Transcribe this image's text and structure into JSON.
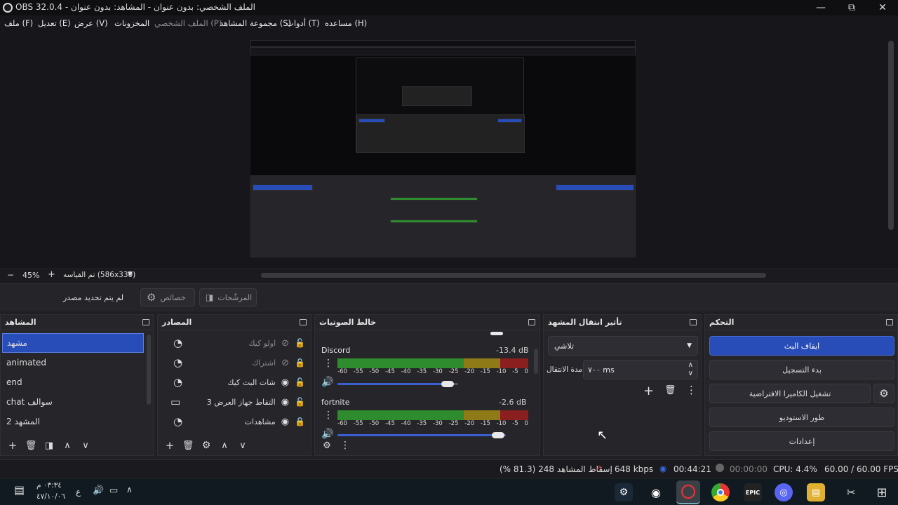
{
  "window": {
    "title": "OBS 32.0.4 - الملف الشخصي: بدون عنوان - المشاهد: بدون عنوان"
  },
  "menu": [
    {
      "label": "مساعده (H)"
    },
    {
      "label": "أدوات (T)"
    },
    {
      "label": "مجموعة المشاهد (S)"
    },
    {
      "label": "الملف الشخصي (P)"
    },
    {
      "label": "المخزونات"
    },
    {
      "label": "عرض (V)"
    },
    {
      "label": "تعديل (E)"
    },
    {
      "label": "ملف (F)"
    }
  ],
  "preview_bar": {
    "zoom": "45%",
    "scale": "تم القياسه (586x330)",
    "minus": "−",
    "plus": "+"
  },
  "context": {
    "no_source": "لم يتم تحديد مصدر",
    "properties": "خصائص",
    "filters": "المرشّحات"
  },
  "docks": {
    "scenes": {
      "title": "المشاهد",
      "items": [
        "مشهد",
        "animated",
        "end",
        "chat سوالف",
        "المشهد 2"
      ]
    },
    "sources": {
      "title": "المصادر",
      "items": [
        "اولو كيك",
        "اشتراك",
        "شات البث كيك",
        "التقاط جهاز العرض 3",
        "مشاهدات"
      ]
    },
    "mixer": {
      "title": "خالط الصوتيات",
      "channels": [
        {
          "name": "Discord",
          "db": "-13.4 dB",
          "level": 0.42
        },
        {
          "name": "fortnite",
          "db": "-2.6 dB",
          "level": 0.6
        }
      ],
      "ticks": [
        "-60",
        "-55",
        "-50",
        "-45",
        "-40",
        "-35",
        "-30",
        "-25",
        "-20",
        "-15",
        "-10",
        "-5",
        "0"
      ]
    },
    "transitions": {
      "title": "تأثير انتقال المشهد",
      "selected": "تلاشي",
      "duration_label": "مدة الانتقال",
      "duration": "٧٠٠ ms"
    },
    "controls": {
      "title": "التحكم",
      "stop_stream": "ايقاف البث",
      "start_record": "بدء التسجيل",
      "virtual_cam": "تشغيل الكاميرا الافتراضية",
      "studio_mode": "طور الاستوديو",
      "settings": "إعدادات"
    }
  },
  "status": {
    "dropped": "إسقاط المشاهد 248 (81.3 %)",
    "bitrate": "648 kbps",
    "stream_time": "00:44:21",
    "record_time": "00:00:00",
    "cpu": "CPU: 4.4%",
    "fps": "60.00 / 60.00 FPS"
  },
  "taskbar": {
    "time": "٠٣:٣٤ م",
    "date": "٤٧/١٠/٠٦",
    "lang": "ع"
  },
  "colors": {
    "accent": "#284cb8",
    "meter_green": "#2e8b2e",
    "meter_yellow": "#8f7a18",
    "meter_red": "#8b1e1e"
  }
}
